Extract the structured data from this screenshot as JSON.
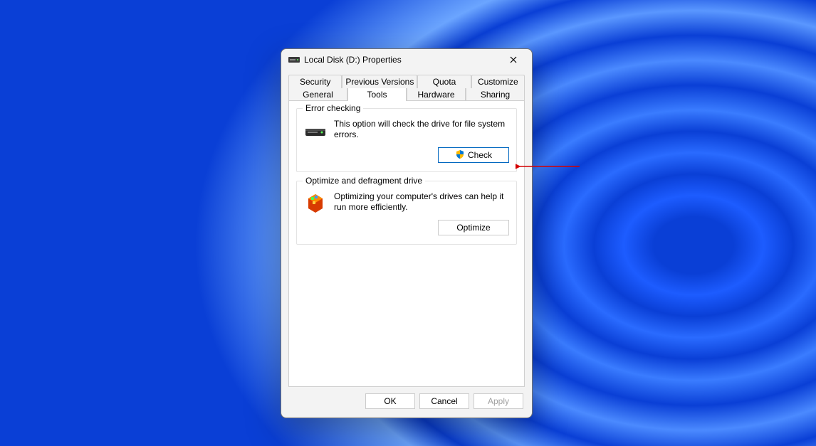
{
  "window": {
    "title": "Local Disk (D:) Properties"
  },
  "tabs": {
    "row1": [
      "Security",
      "Previous Versions",
      "Quota",
      "Customize"
    ],
    "row2": [
      "General",
      "Tools",
      "Hardware",
      "Sharing"
    ],
    "active": "Tools"
  },
  "errorChecking": {
    "legend": "Error checking",
    "description": "This option will check the drive for file system errors.",
    "button": "Check"
  },
  "optimize": {
    "legend": "Optimize and defragment drive",
    "description": "Optimizing your computer's drives can help it run more efficiently.",
    "button": "Optimize"
  },
  "buttons": {
    "ok": "OK",
    "cancel": "Cancel",
    "apply": "Apply"
  }
}
